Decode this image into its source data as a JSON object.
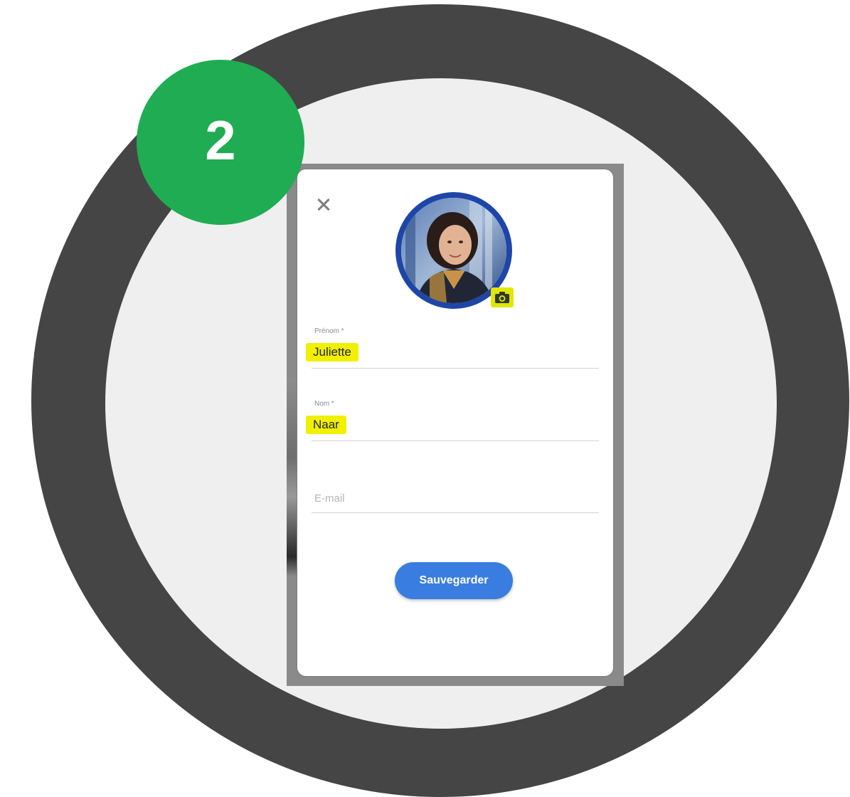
{
  "step": {
    "number": "2",
    "color": "#1fac52"
  },
  "dialog": {
    "close_icon": "close-icon",
    "avatar_icon": "profile-photo",
    "camera_icon": "camera-icon",
    "fields": {
      "first_name": {
        "label": "Prénom *",
        "value": "Juliette"
      },
      "last_name": {
        "label": "Nom *",
        "value": "Naar"
      },
      "email": {
        "placeholder": "E-mail"
      }
    },
    "save_label": "Sauvegarder"
  },
  "colors": {
    "ring": "#454545",
    "disc": "#efefef",
    "highlight": "#f1f000",
    "button": "#3a7de0",
    "avatar_border": "#1e46a8"
  }
}
